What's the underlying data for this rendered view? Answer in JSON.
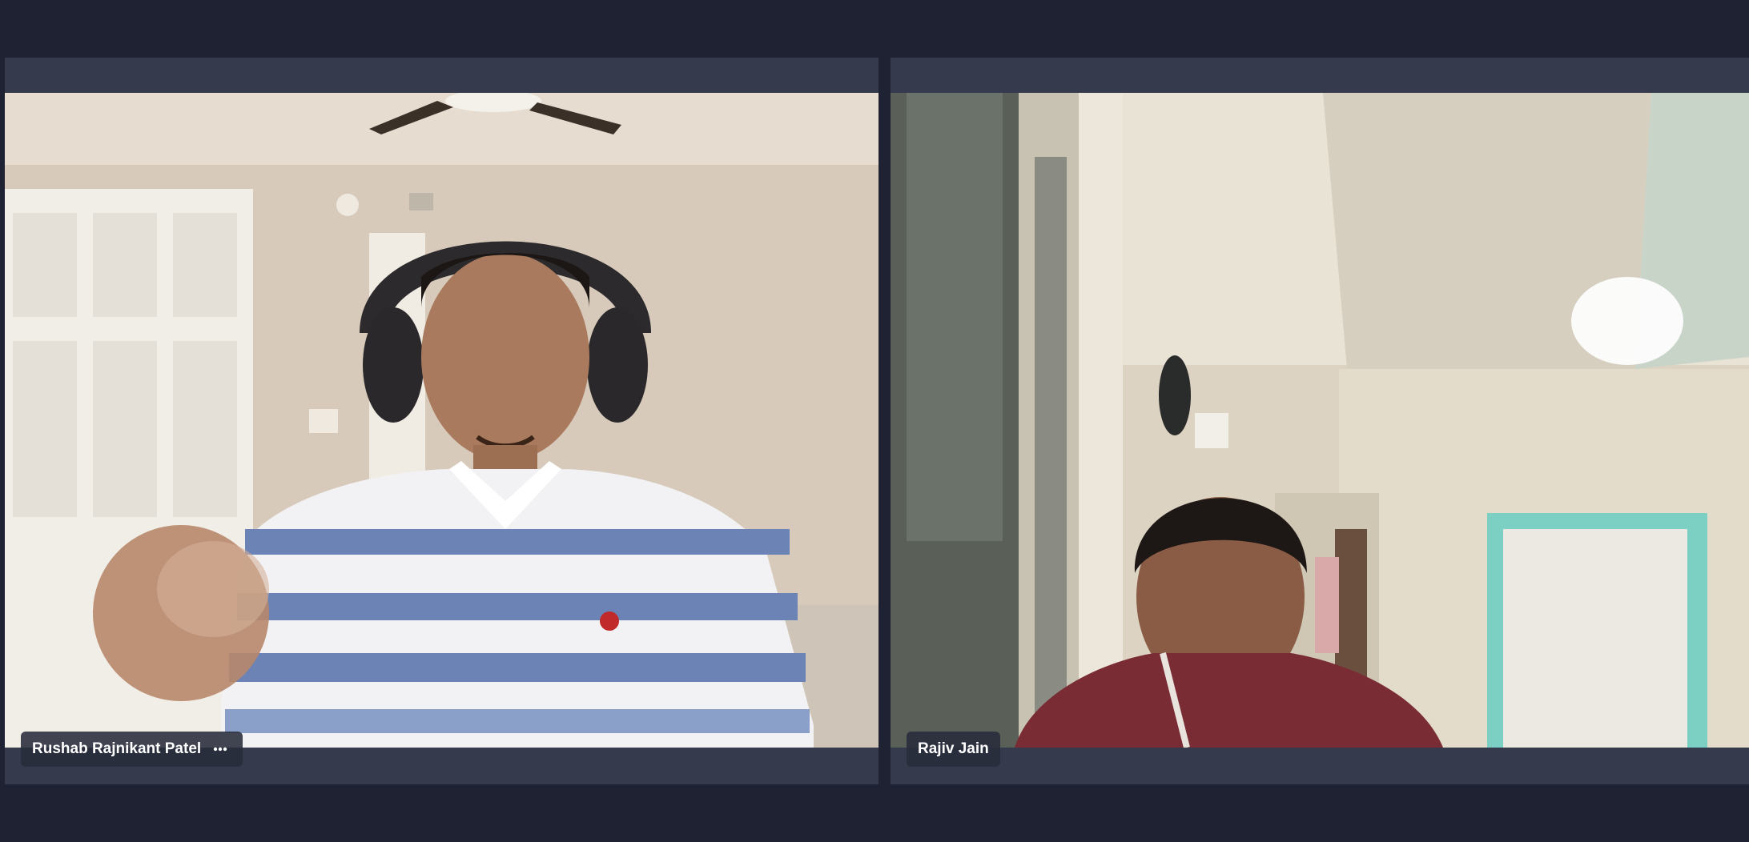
{
  "meeting": {
    "participants": [
      {
        "name": "Rushab Rajnikant Patel",
        "more_options_icon": "more-horizontal-icon",
        "video_state": "on"
      },
      {
        "name": "Rajiv Jain",
        "video_state": "on"
      }
    ]
  },
  "colors": {
    "background": "#1e2233",
    "tile": "#353a4c",
    "name_tag": "#282c3a",
    "name_text": "#ffffff"
  }
}
